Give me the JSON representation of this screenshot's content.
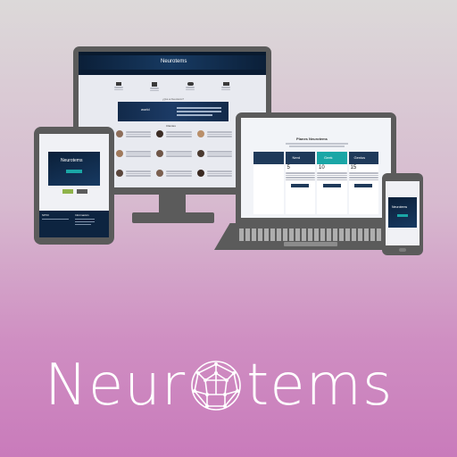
{
  "brand": {
    "name_prefix": "Neur",
    "name_suffix": "tems",
    "logo_icon": "geodesic-sphere-icon",
    "colors": {
      "navy": "#0d2440",
      "teal": "#1aa6a6",
      "device_gray": "#5b5b5b",
      "text_white": "#ffffff"
    }
  },
  "monitor": {
    "header_title": "Neurotems",
    "banner_word": "world",
    "section_title": "Clientes",
    "section_heading": "¿Qué es Neurotems?"
  },
  "laptop": {
    "pricing_title": "Planes Neurotems",
    "plans": [
      {
        "name": "Nerd",
        "price": "5",
        "color": "#1f3a5a"
      },
      {
        "name": "Nerd",
        "price": "5",
        "color": "#1f3a5a"
      },
      {
        "name": "Geek",
        "price": "10",
        "color": "#1aa6a6"
      },
      {
        "name": "Genius",
        "price": "15",
        "color": "#1f3a5a"
      }
    ]
  },
  "tablet": {
    "logo_text": "Neurotems",
    "section": "Información",
    "footer_label": "SITIO"
  },
  "phone": {
    "logo_text": "Neurotems"
  }
}
